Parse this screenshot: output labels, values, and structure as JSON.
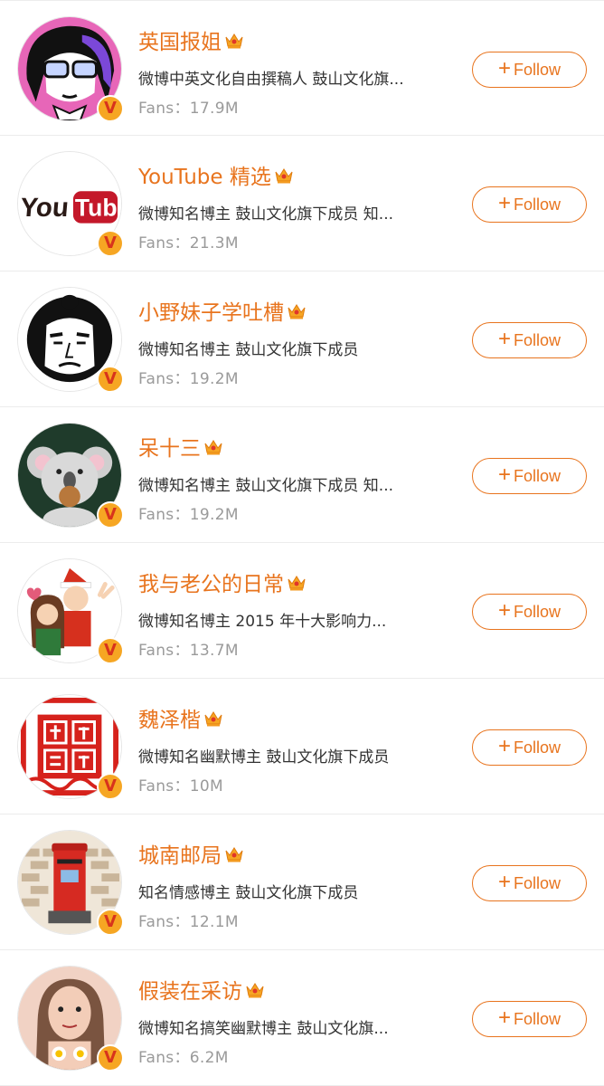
{
  "follow_label": "Follow",
  "fans_label": "Fans：",
  "accounts": [
    {
      "name": "英国报姐",
      "desc": "微博中英文化自由撰稿人 鼓山文化旗...",
      "fans": "17.9M",
      "avatar_icon": "cartoon-girl-glasses-avatar"
    },
    {
      "name": "YouTube 精选",
      "desc": "微博知名博主  鼓山文化旗下成员  知...",
      "fans": "21.3M",
      "avatar_icon": "youtube-logo-avatar"
    },
    {
      "name": "小野妹子学吐槽",
      "desc": "微博知名博主 鼓山文化旗下成员",
      "fans": "19.2M",
      "avatar_icon": "ink-samurai-avatar"
    },
    {
      "name": "呆十三",
      "desc": "微博知名博主  鼓山文化旗下成员  知...",
      "fans": "19.2M",
      "avatar_icon": "koala-cookie-avatar"
    },
    {
      "name": "我与老公的日常",
      "desc": "微博知名博主 2015 年十大影响力...",
      "fans": "13.7M",
      "avatar_icon": "christmas-couple-avatar"
    },
    {
      "name": "魏泽楷",
      "desc": "微博知名幽默博主 鼓山文化旗下成员",
      "fans": "10M",
      "avatar_icon": "red-seal-avatar"
    },
    {
      "name": "城南邮局",
      "desc": "知名情感博主 鼓山文化旗下成员",
      "fans": "12.1M",
      "avatar_icon": "red-postbox-avatar"
    },
    {
      "name": "假装在采访",
      "desc": "微博知名搞笑幽默博主 鼓山文化旗...",
      "fans": "6.2M",
      "avatar_icon": "cartoon-woman-avatar"
    }
  ],
  "colors": {
    "accent": "#e8741e",
    "badge_bg": "#f6a623",
    "badge_v": "#d8331c",
    "fans_text": "#9a9a9a"
  }
}
